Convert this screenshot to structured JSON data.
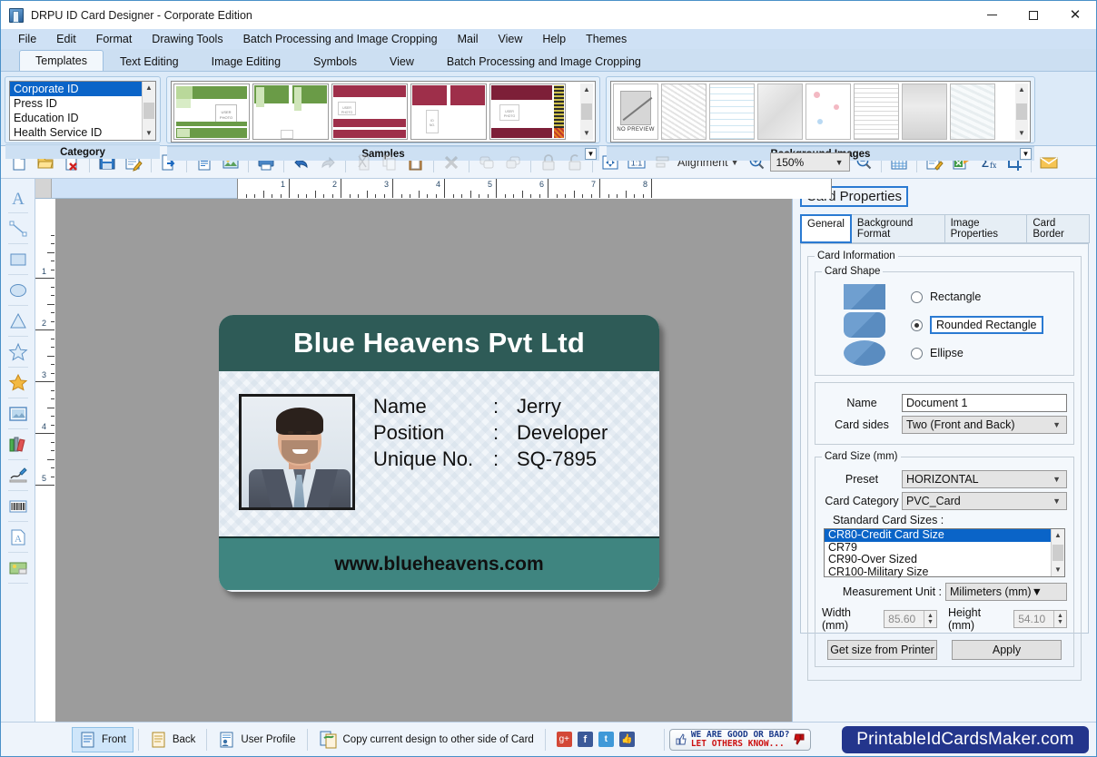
{
  "window": {
    "title": "DRPU ID Card Designer - Corporate Edition",
    "app_icon": "id-card-app-icon",
    "minimize": "–",
    "maximize": "□",
    "close": "✕"
  },
  "menubar": {
    "items": [
      {
        "label": "File",
        "mnemonic": "F"
      },
      {
        "label": "Edit",
        "mnemonic": "E"
      },
      {
        "label": "Format",
        "mnemonic": "o"
      },
      {
        "label": "Drawing Tools",
        "mnemonic": "D"
      },
      {
        "label": "Batch Processing and Image Cropping",
        "mnemonic": "B"
      },
      {
        "label": "Mail",
        "mnemonic": "M"
      },
      {
        "label": "View",
        "mnemonic": "V"
      },
      {
        "label": "Help",
        "mnemonic": "H"
      },
      {
        "label": "Themes",
        "mnemonic": ""
      }
    ]
  },
  "ribbon": {
    "tabs": [
      {
        "label": "Templates",
        "active": true
      },
      {
        "label": "Text Editing",
        "active": false
      },
      {
        "label": "Image Editing",
        "active": false
      },
      {
        "label": "Symbols",
        "active": false
      },
      {
        "label": "View",
        "active": false
      },
      {
        "label": "Batch Processing and Image Cropping",
        "active": false
      }
    ],
    "category_group": {
      "caption": "Category",
      "items": [
        {
          "label": "Corporate ID",
          "selected": true
        },
        {
          "label": "Press ID",
          "selected": false
        },
        {
          "label": "Education ID",
          "selected": false
        },
        {
          "label": "Health Service ID",
          "selected": false
        }
      ]
    },
    "samples_group": {
      "caption": "Samples",
      "thumbnail_count": 5,
      "photo_placeholder_label": "USER PHOTO",
      "id_placeholder_label": "ID NO."
    },
    "background_group": {
      "caption": "Background Images",
      "first_thumb_label": "NO PREVIEW",
      "thumbnail_count": 8
    }
  },
  "toolbar": {
    "buttons": [
      {
        "name": "new-document",
        "title": "New"
      },
      {
        "name": "open-document",
        "title": "Open"
      },
      {
        "name": "delete-document",
        "title": "Delete"
      },
      {
        "name": "save-document",
        "title": "Save"
      },
      {
        "name": "save-as-document",
        "title": "Save As"
      },
      {
        "name": "export-document",
        "title": "Export"
      },
      {
        "name": "text-object",
        "title": "Text"
      },
      {
        "name": "image-object",
        "title": "Image"
      },
      {
        "name": "print-document",
        "title": "Print"
      },
      {
        "name": "undo",
        "title": "Undo"
      },
      {
        "name": "redo",
        "title": "Redo"
      },
      {
        "name": "cut",
        "title": "Cut"
      },
      {
        "name": "copy",
        "title": "Copy"
      },
      {
        "name": "paste",
        "title": "Paste"
      },
      {
        "name": "delete-object",
        "title": "Delete"
      },
      {
        "name": "bring-to-front",
        "title": "Bring to Front"
      },
      {
        "name": "send-to-back",
        "title": "Send to Back"
      },
      {
        "name": "lock",
        "title": "Lock"
      },
      {
        "name": "unlock",
        "title": "Unlock"
      },
      {
        "name": "fit-to-window",
        "title": "Fit to Window"
      },
      {
        "name": "actual-size",
        "title": "1:1"
      },
      {
        "name": "grid",
        "title": "Grid"
      },
      {
        "name": "batch-processing",
        "title": "Batch Processing"
      },
      {
        "name": "excel-import",
        "title": "Import From Excel"
      },
      {
        "name": "sum-function",
        "title": "Sum"
      },
      {
        "name": "crop",
        "title": "Crop"
      },
      {
        "name": "mail",
        "title": "Mail"
      }
    ],
    "alignment_label": "Alignment",
    "zoom_value": "150%",
    "one_to_one_label": "1:1"
  },
  "left_tools": [
    {
      "name": "text-tool",
      "label": "A"
    },
    {
      "name": "line-tool",
      "label": "Line"
    },
    {
      "name": "rectangle-tool",
      "label": "Rectangle"
    },
    {
      "name": "ellipse-tool",
      "label": "Ellipse"
    },
    {
      "name": "triangle-tool",
      "label": "Triangle"
    },
    {
      "name": "star-tool",
      "label": "Star"
    },
    {
      "name": "symbol-tool",
      "label": "Symbol"
    },
    {
      "name": "picture-tool",
      "label": "Picture"
    },
    {
      "name": "library-tool",
      "label": "Library"
    },
    {
      "name": "signature-tool",
      "label": "Signature"
    },
    {
      "name": "barcode-tool",
      "label": "Barcode"
    },
    {
      "name": "watermark-tool",
      "label": "Watermark"
    },
    {
      "name": "background-tool",
      "label": "Background"
    }
  ],
  "rulers": {
    "horizontal_ticks": [
      "1",
      "2",
      "3",
      "4",
      "5",
      "6",
      "7",
      "8"
    ],
    "vertical_ticks": [
      "1",
      "2",
      "3",
      "4",
      "5"
    ]
  },
  "card": {
    "company_name": "Blue Heavens Pvt Ltd",
    "website": "www.blueheavens.com",
    "header_color": "#2e5b57",
    "footer_color": "#3f8580",
    "photo_alt": "employee-photo",
    "fields": [
      {
        "label": "Name",
        "colon": ":",
        "value": "Jerry"
      },
      {
        "label": "Position",
        "colon": ":",
        "value": "Developer"
      },
      {
        "label": "Unique No.",
        "colon": ":",
        "value": "SQ-7895"
      }
    ]
  },
  "card_properties": {
    "panel_title": "Card Properties",
    "tabs": [
      {
        "label": "General",
        "active": true
      },
      {
        "label": "Background Format",
        "active": false
      },
      {
        "label": "Image Properties",
        "active": false
      },
      {
        "label": "Card Border",
        "active": false
      }
    ],
    "card_information_legend": "Card Information",
    "card_shape_legend": "Card Shape",
    "shapes": [
      {
        "label": "Rectangle",
        "selected": false,
        "shape": "rect"
      },
      {
        "label": "Rounded Rectangle",
        "selected": true,
        "shape": "round"
      },
      {
        "label": "Ellipse",
        "selected": false,
        "shape": "ellipse"
      }
    ],
    "name_label": "Name",
    "name_value": "Document 1",
    "card_sides_label": "Card sides",
    "card_sides_value": "Two (Front and Back)",
    "card_size_legend": "Card Size (mm)",
    "preset_label": "Preset",
    "preset_value": "HORIZONTAL",
    "card_category_label": "Card Category",
    "card_category_value": "PVC_Card",
    "standard_sizes_label": "Standard Card Sizes :",
    "standard_sizes": [
      {
        "label": "CR80-Credit Card Size",
        "selected": true
      },
      {
        "label": "CR79",
        "selected": false
      },
      {
        "label": "CR90-Over Sized",
        "selected": false
      },
      {
        "label": "CR100-Military Size",
        "selected": false
      }
    ],
    "measurement_unit_label": "Measurement Unit :",
    "measurement_unit_value": "Milimeters (mm)",
    "width_label": "Width  (mm)",
    "width_value": "85.60",
    "height_label": "Height   (mm)",
    "height_value": "54.10",
    "get_size_button": "Get size from Printer",
    "apply_button": "Apply"
  },
  "statusbar": {
    "front_label": "Front",
    "back_label": "Back",
    "user_profile_label": "User Profile",
    "copy_design_label": "Copy current design to other side of Card",
    "social": [
      {
        "name": "google-plus-icon",
        "color": "#d34836",
        "glyph": "g+"
      },
      {
        "name": "facebook-icon",
        "color": "#3b5998",
        "glyph": "f"
      },
      {
        "name": "twitter-icon",
        "color": "#4099d8",
        "glyph": "t"
      },
      {
        "name": "thumbs-up-icon",
        "color": "#3b5998",
        "glyph": "✓"
      }
    ],
    "feedback_line1": "WE ARE GOOD OR BAD?",
    "feedback_line2": "LET OTHERS KNOW...",
    "brand": "PrintableIdCardsMaker.com",
    "brand_color": "#23358c"
  }
}
